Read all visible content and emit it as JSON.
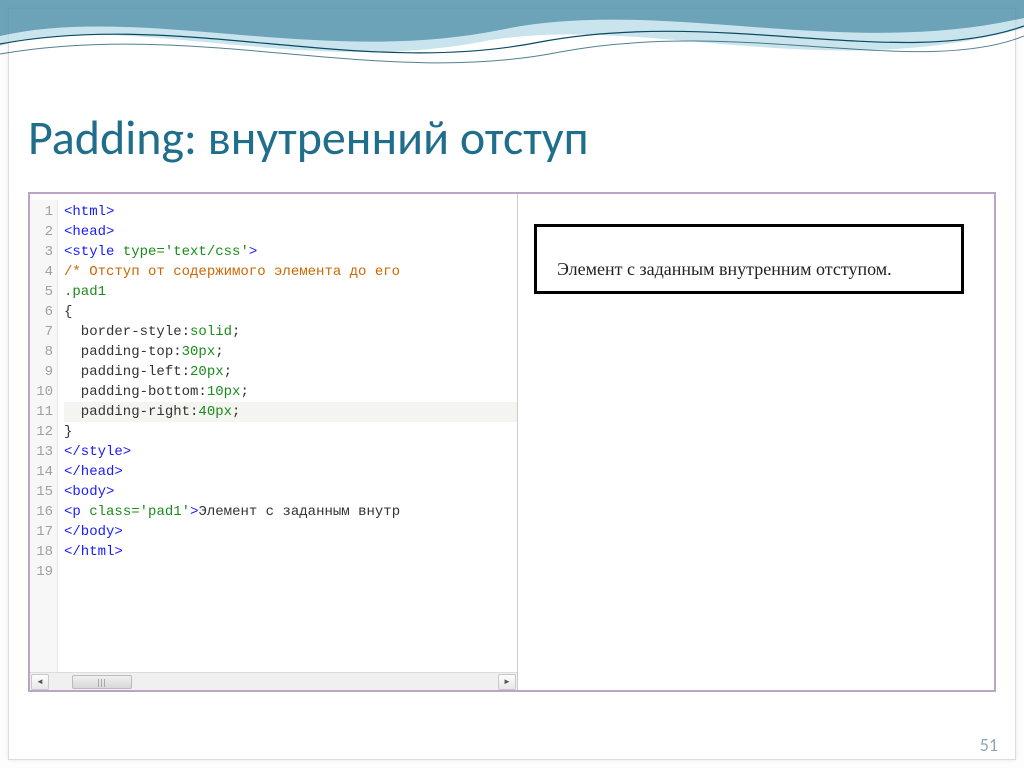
{
  "title": "Padding: внутренний отступ",
  "page_number": "51",
  "code": {
    "line_numbers": [
      "1",
      "2",
      "3",
      "4",
      "5",
      "6",
      "7",
      "8",
      "9",
      "10",
      "11",
      "12",
      "13",
      "14",
      "15",
      "16",
      "17",
      "18",
      "19"
    ],
    "lines": [
      {
        "t": "tag",
        "text": "<html>"
      },
      {
        "t": "tag",
        "text": "<head>"
      },
      {
        "t": "styleopen",
        "open": "<style ",
        "attr": "type=",
        "val": "'text/css'",
        "close": ">"
      },
      {
        "t": "comment",
        "text": "/* Отступ от содержимого элемента до его"
      },
      {
        "t": "sel",
        "text": ".pad1"
      },
      {
        "t": "plain",
        "text": "{"
      },
      {
        "t": "decl",
        "prop": "  border-style:",
        "val": "solid",
        "semi": ";"
      },
      {
        "t": "decl",
        "prop": "  padding-top:",
        "val": "30px",
        "semi": ";"
      },
      {
        "t": "decl",
        "prop": "  padding-left:",
        "val": "20px",
        "semi": ";"
      },
      {
        "t": "decl",
        "prop": "  padding-bottom:",
        "val": "10px",
        "semi": ";"
      },
      {
        "t": "decl",
        "prop": "  padding-right:",
        "val": "40px",
        "semi": ";",
        "hl": true
      },
      {
        "t": "plain",
        "text": "}"
      },
      {
        "t": "tag",
        "text": "</style>"
      },
      {
        "t": "tag",
        "text": "</head>"
      },
      {
        "t": "tag",
        "text": "<body>"
      },
      {
        "t": "pline",
        "open": "<p ",
        "attr": "class=",
        "val": "'pad1'",
        "close": ">",
        "content": "Элемент с заданным внутр"
      },
      {
        "t": "tag",
        "text": "</body>"
      },
      {
        "t": "tag",
        "text": "</html>"
      },
      {
        "t": "plain",
        "text": ""
      }
    ]
  },
  "preview": {
    "text": "Элемент с заданным внутренним отступом."
  },
  "scrollbar": {
    "left_arrow": "◄",
    "right_arrow": "►"
  }
}
